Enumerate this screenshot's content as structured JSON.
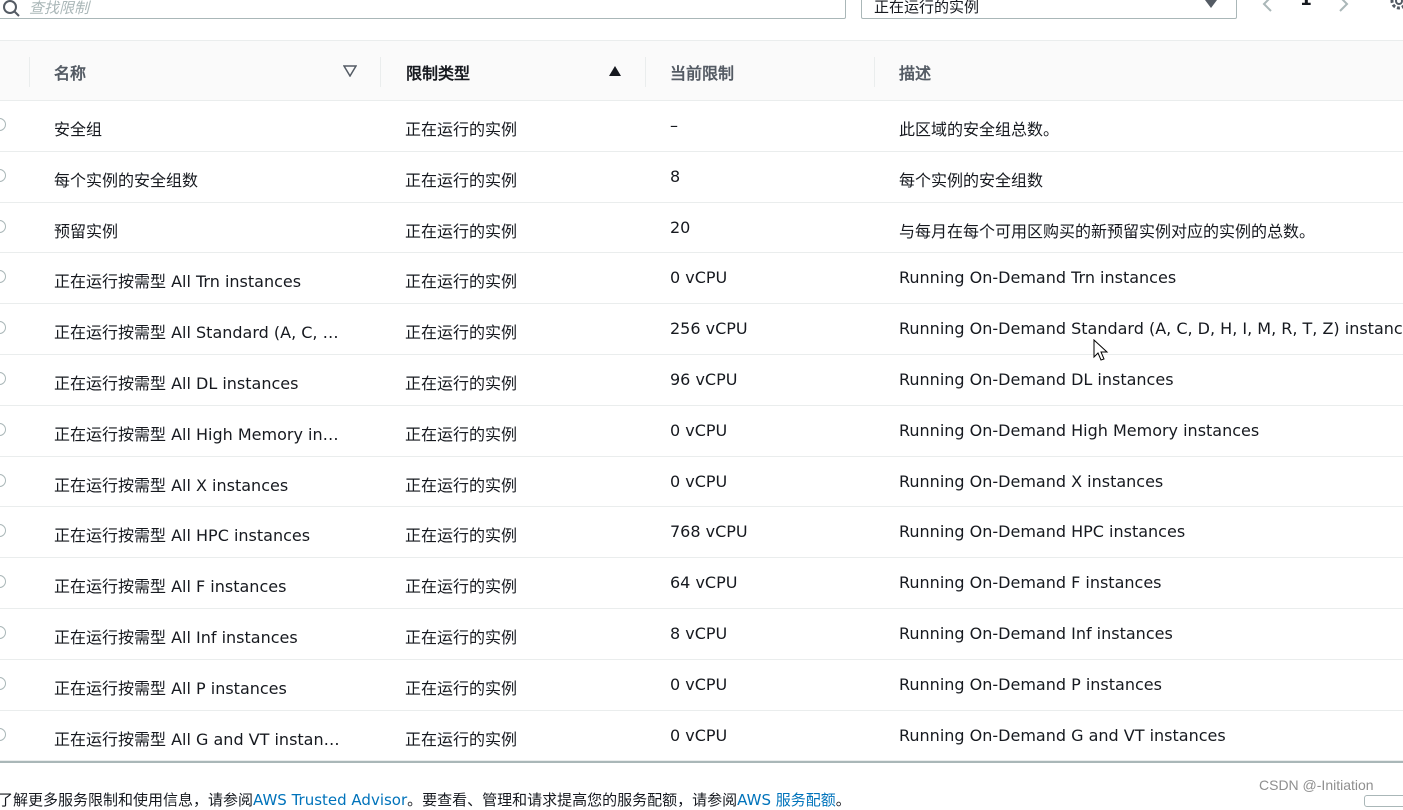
{
  "toolbar": {
    "search_placeholder": "查找限制",
    "filter_value": "正在运行的实例",
    "current_page": "1"
  },
  "table": {
    "columns": [
      "名称",
      "限制类型",
      "当前限制",
      "描述"
    ],
    "rows": [
      {
        "name": "安全组",
        "type": "正在运行的实例",
        "limit": "–",
        "desc": "此区域的安全组总数。"
      },
      {
        "name": "每个实例的安全组数",
        "type": "正在运行的实例",
        "limit": "8",
        "desc": "每个实例的安全组数"
      },
      {
        "name": "预留实例",
        "type": "正在运行的实例",
        "limit": "20",
        "desc": "与每月在每个可用区购买的新预留实例对应的实例的总数。"
      },
      {
        "name": "正在运行按需型 All Trn instances",
        "type": "正在运行的实例",
        "limit": "0 vCPU",
        "desc": "Running On-Demand Trn instances"
      },
      {
        "name": "正在运行按需型 All Standard (A, C, …",
        "type": "正在运行的实例",
        "limit": "256 vCPU",
        "desc": "Running On-Demand Standard (A, C, D, H, I, M, R, T, Z) instances"
      },
      {
        "name": "正在运行按需型 All DL instances",
        "type": "正在运行的实例",
        "limit": "96 vCPU",
        "desc": "Running On-Demand DL instances"
      },
      {
        "name": "正在运行按需型 All High Memory in…",
        "type": "正在运行的实例",
        "limit": "0 vCPU",
        "desc": "Running On-Demand High Memory instances"
      },
      {
        "name": "正在运行按需型 All X instances",
        "type": "正在运行的实例",
        "limit": "0 vCPU",
        "desc": "Running On-Demand X instances"
      },
      {
        "name": "正在运行按需型 All HPC instances",
        "type": "正在运行的实例",
        "limit": "768 vCPU",
        "desc": "Running On-Demand HPC instances"
      },
      {
        "name": "正在运行按需型 All F instances",
        "type": "正在运行的实例",
        "limit": "64 vCPU",
        "desc": "Running On-Demand F instances"
      },
      {
        "name": "正在运行按需型 All Inf instances",
        "type": "正在运行的实例",
        "limit": "8 vCPU",
        "desc": "Running On-Demand Inf instances"
      },
      {
        "name": "正在运行按需型 All P instances",
        "type": "正在运行的实例",
        "limit": "0 vCPU",
        "desc": "Running On-Demand P instances"
      },
      {
        "name": "正在运行按需型 All G and VT instan…",
        "type": "正在运行的实例",
        "limit": "0 vCPU",
        "desc": "Running On-Demand G and VT instances"
      }
    ]
  },
  "footer": {
    "text1": "了解更多服务限制和使用信息，请参阅",
    "link1": "AWS Trusted Advisor",
    "text2": "。要查看、管理和请求提高您的服务配额，请参阅",
    "link2": "AWS 服务配额",
    "text3": "。"
  },
  "watermark": "CSDN @-Initiation",
  "colors": {
    "link": "#0073bb",
    "header_text": "#545b64",
    "border": "#eaeded"
  }
}
